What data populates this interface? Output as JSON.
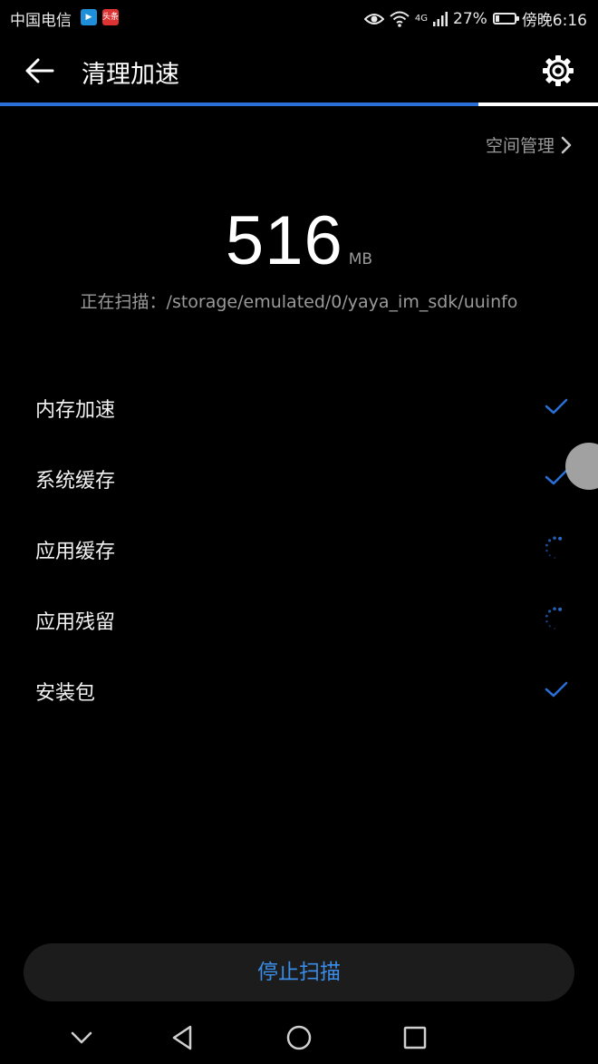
{
  "status_bar": {
    "carrier": "中国电信",
    "news_badge": "头条",
    "network": "4G",
    "battery_percent": "27%",
    "battery_level": 0.27,
    "time": "傍晚6:16"
  },
  "app_bar": {
    "title": "清理加速"
  },
  "scan_progress": 0.8,
  "space_manage": {
    "label": "空间管理"
  },
  "scan_result": {
    "size": "516",
    "unit": "MB",
    "scanning_text": "正在扫描：/storage/emulated/0/yaya_im_sdk/uuinfo"
  },
  "items": [
    {
      "label": "内存加速",
      "status": "done"
    },
    {
      "label": "系统缓存",
      "status": "done"
    },
    {
      "label": "应用缓存",
      "status": "loading"
    },
    {
      "label": "应用残留",
      "status": "loading"
    },
    {
      "label": "安装包",
      "status": "done"
    }
  ],
  "stop_button": {
    "label": "停止扫描"
  },
  "colors": {
    "accent": "#2a6fd6",
    "button_text": "#3a8ce6",
    "secondary_text": "#9a9a9a"
  },
  "nav": [
    "chevron-down-icon",
    "back-triangle-icon",
    "home-circle-icon",
    "recents-square-icon"
  ]
}
